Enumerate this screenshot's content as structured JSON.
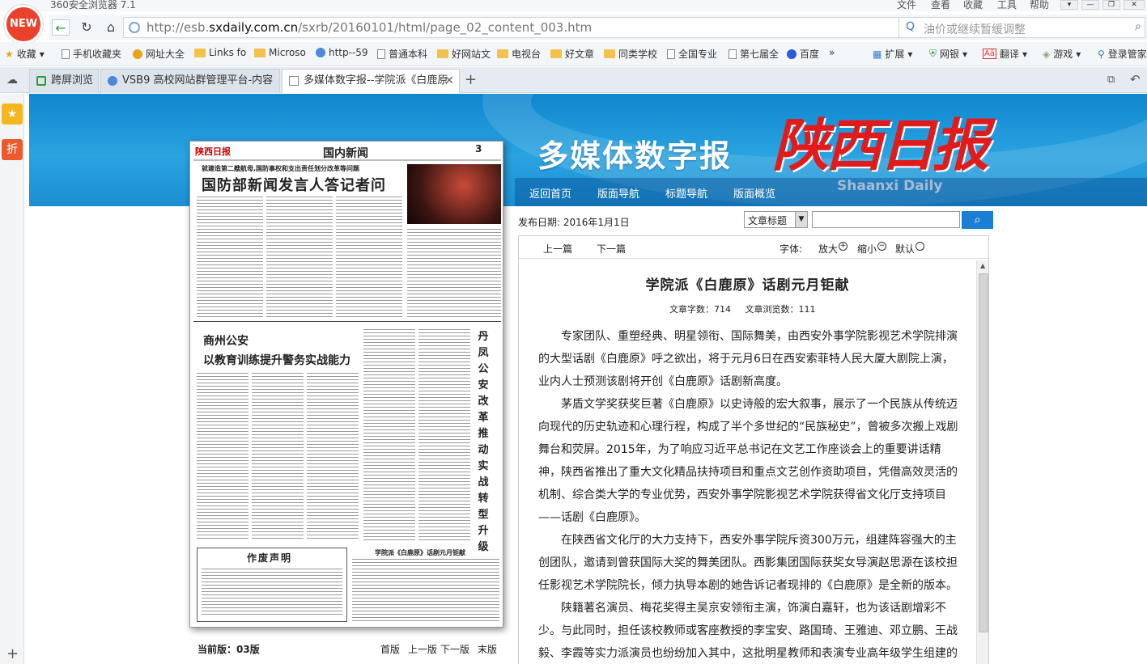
{
  "browser": {
    "title": "360安全浏览器 7.1",
    "logo": "NEW",
    "menu": [
      "文件",
      "查看",
      "收藏",
      "工具",
      "帮助"
    ],
    "url_prefix": "http://esb.",
    "url_domain": "sxdaily.com.cn",
    "url_path": "/sxrb/20160101/html/page_02_content_003.htm",
    "search_placeholder": "油价或继续暂缓调整",
    "bookmarks": [
      "收藏",
      "手机收藏夹",
      "网址大全",
      "Links fo",
      "Microso",
      "http--59",
      "普通本科",
      "好网站文",
      "电视台",
      "好文章",
      "同类学校",
      "全国专业",
      "第七届全",
      "百度"
    ],
    "toolbar_right": [
      "扩展",
      "网银",
      "翻译",
      "游戏",
      "登录管家"
    ],
    "tabs": [
      {
        "label": "跨屏浏览"
      },
      {
        "label": "VSB9 高校网站群管理平台-内容"
      },
      {
        "label": "多媒体数字报--学院派《白鹿原"
      }
    ],
    "sidebar": [
      "★",
      "折"
    ]
  },
  "banner": {
    "title": "多媒体数字报",
    "logo": "陕西日报",
    "logo_en": "Shaanxi Daily",
    "nav": [
      "返回首页",
      "版面导航",
      "标题导航",
      "版面概览"
    ]
  },
  "paper": {
    "masthead": "陕西日报",
    "section": "国内新闻",
    "page_no": "3",
    "sub1": "就建造第二艘航母,国防事权和支出责任划分改革等问题",
    "h1": "国防部新闻发言人答记者问",
    "h2a": "商州公安",
    "h2b": "以教育训练提升警务实战能力",
    "vertical": "丹凤公安改革推动实战转型升级",
    "h3": "作废声明",
    "h4": "学院派《白鹿原》话剧元月钜献"
  },
  "pager": {
    "current": "当前版：03版",
    "links": [
      "首版",
      "上一版",
      "下一版",
      "末版"
    ]
  },
  "article_meta": {
    "pub_date": "发布日期:  2016年1月1日",
    "search_select": "文章标题"
  },
  "article": {
    "prev": "上一篇",
    "next": "下一篇",
    "font_label": "字体:",
    "zoom_in": "放大",
    "zoom_out": "缩小",
    "default": "默认",
    "title": "学院派《白鹿原》话剧元月钜献",
    "char_count": "文章字数：714",
    "view_count": "文章浏览数：111",
    "paragraphs": [
      "专家团队、重塑经典、明星领衔、国际舞美，由西安外事学院影视艺术学院排演的大型话剧《白鹿原》呼之欲出，将于元月6日在西安索菲特人民大厦大剧院上演，业内人士预测该剧将开创《白鹿原》话剧新高度。",
      "茅盾文学奖获奖巨著《白鹿原》以史诗般的宏大叙事，展示了一个民族从传统迈向现代的历史轨迹和心理行程，构成了半个多世纪的“民族秘史”，曾被多次搬上戏剧舞台和荧屏。2015年，为了响应习近平总书记在文艺工作座谈会上的重要讲话精神，陕西省推出了重大文化精品扶持项目和重点文艺创作资助项目，凭借高效灵活的机制、综合类大学的专业优势，西安外事学院影视艺术学院获得省文化厅支持项目——话剧《白鹿原》。",
      "在陕西省文化厅的大力支持下，西安外事学院斥资300万元，组建阵容强大的主创团队，邀请到曾获国际大奖的舞美团队。西影集团国际获奖女导演赵思源在该校担任影视艺术学院院长，倾力执导本剧的她告诉记者现排的《白鹿原》是全新的版本。",
      "陕籍著名演员、梅花奖得主吴京安领衔主演，饰演白嘉轩，也为该话剧增彩不少。与此同时，担任该校教师或客座教授的李宝安、路国琦、王雅迪、邓立鹏、王战毅、李霞等实力派演员也纷纷加入其中，这批明星教师和表演专业高年级学生组建的"
    ]
  }
}
